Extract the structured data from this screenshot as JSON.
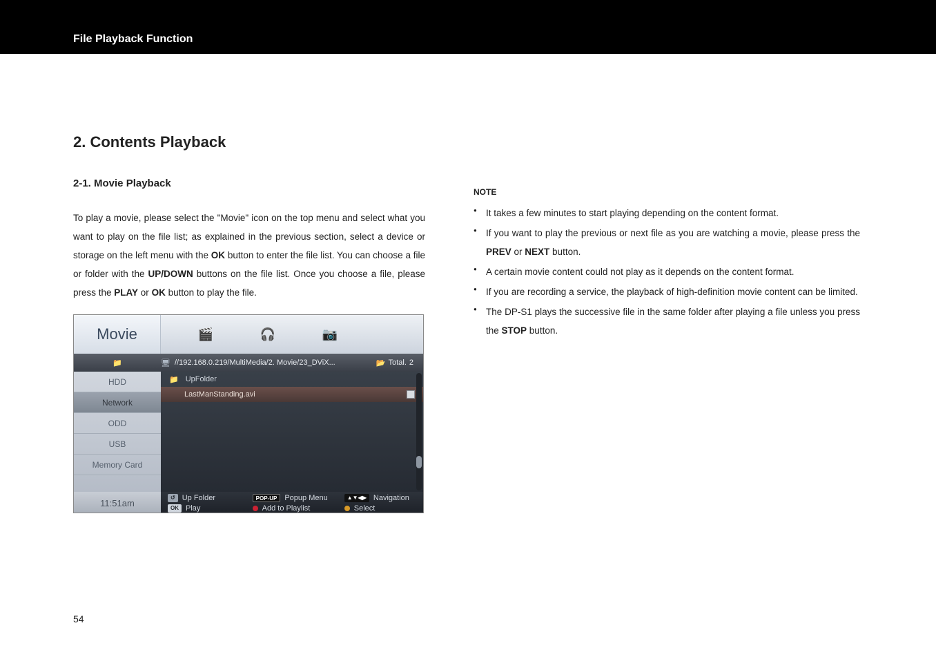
{
  "header": {
    "title": "File Playback Function"
  },
  "page_number": "54",
  "section": {
    "heading": "2. Contents Playback",
    "subheading": "2-1. Movie Playback",
    "paragraph_parts": [
      "To play a movie, please select the \"Movie\" icon on the top menu and select what you want to play on the file list; as explained in the previous section, select a device or storage on the left menu with the ",
      "OK",
      " button to enter the file list. You can choose a file or folder with the ",
      "UP/DOWN",
      " buttons on the file list. Once you choose a file, please press the ",
      "PLAY",
      " or ",
      "OK",
      " button to play the file."
    ]
  },
  "note": {
    "title": "NOTE",
    "bullets": [
      {
        "segments": [
          "It takes a few minutes to start playing depending on the content format."
        ]
      },
      {
        "segments": [
          "If you want to play the previous or next file as you are watching a movie, please press the ",
          "PREV",
          " or ",
          "NEXT",
          " button."
        ],
        "bold_idx": [
          1,
          3
        ]
      },
      {
        "segments": [
          "A certain movie content could not play as it depends on the content format."
        ]
      },
      {
        "segments": [
          "If you are recording a service, the playback of high-definition movie content can be limited."
        ]
      },
      {
        "segments": [
          "The DP-S1 plays the successive file in the same folder after playing a file unless you press the ",
          "STOP",
          " button."
        ],
        "bold_idx": [
          1
        ]
      }
    ]
  },
  "screenshot": {
    "tab_label": "Movie",
    "path": "//192.168.0.219/MultiMedia/2. Movie/23_DViX...",
    "total_label": "Total.",
    "total_value": "2",
    "sidebar": [
      "HDD",
      "Network",
      "ODD",
      "USB",
      "Memory Card"
    ],
    "sidebar_active_index": 1,
    "files": [
      {
        "name": "UpFolder",
        "type": "folder"
      },
      {
        "name": "LastManStanding.avi",
        "type": "file",
        "selected": true
      }
    ],
    "time": "11:51am",
    "hints": {
      "up_folder": "Up Folder",
      "play": "Play",
      "popup_menu": "Popup Menu",
      "add_playlist": "Add to Playlist",
      "navigation": "Navigation",
      "select": "Select",
      "keys": {
        "return": "↺",
        "ok": "OK",
        "popup": "POP-UP",
        "nav": "▲▼◀▶"
      }
    },
    "top_icons": [
      "film-icon",
      "headphones-icon",
      "camera-icon"
    ]
  }
}
